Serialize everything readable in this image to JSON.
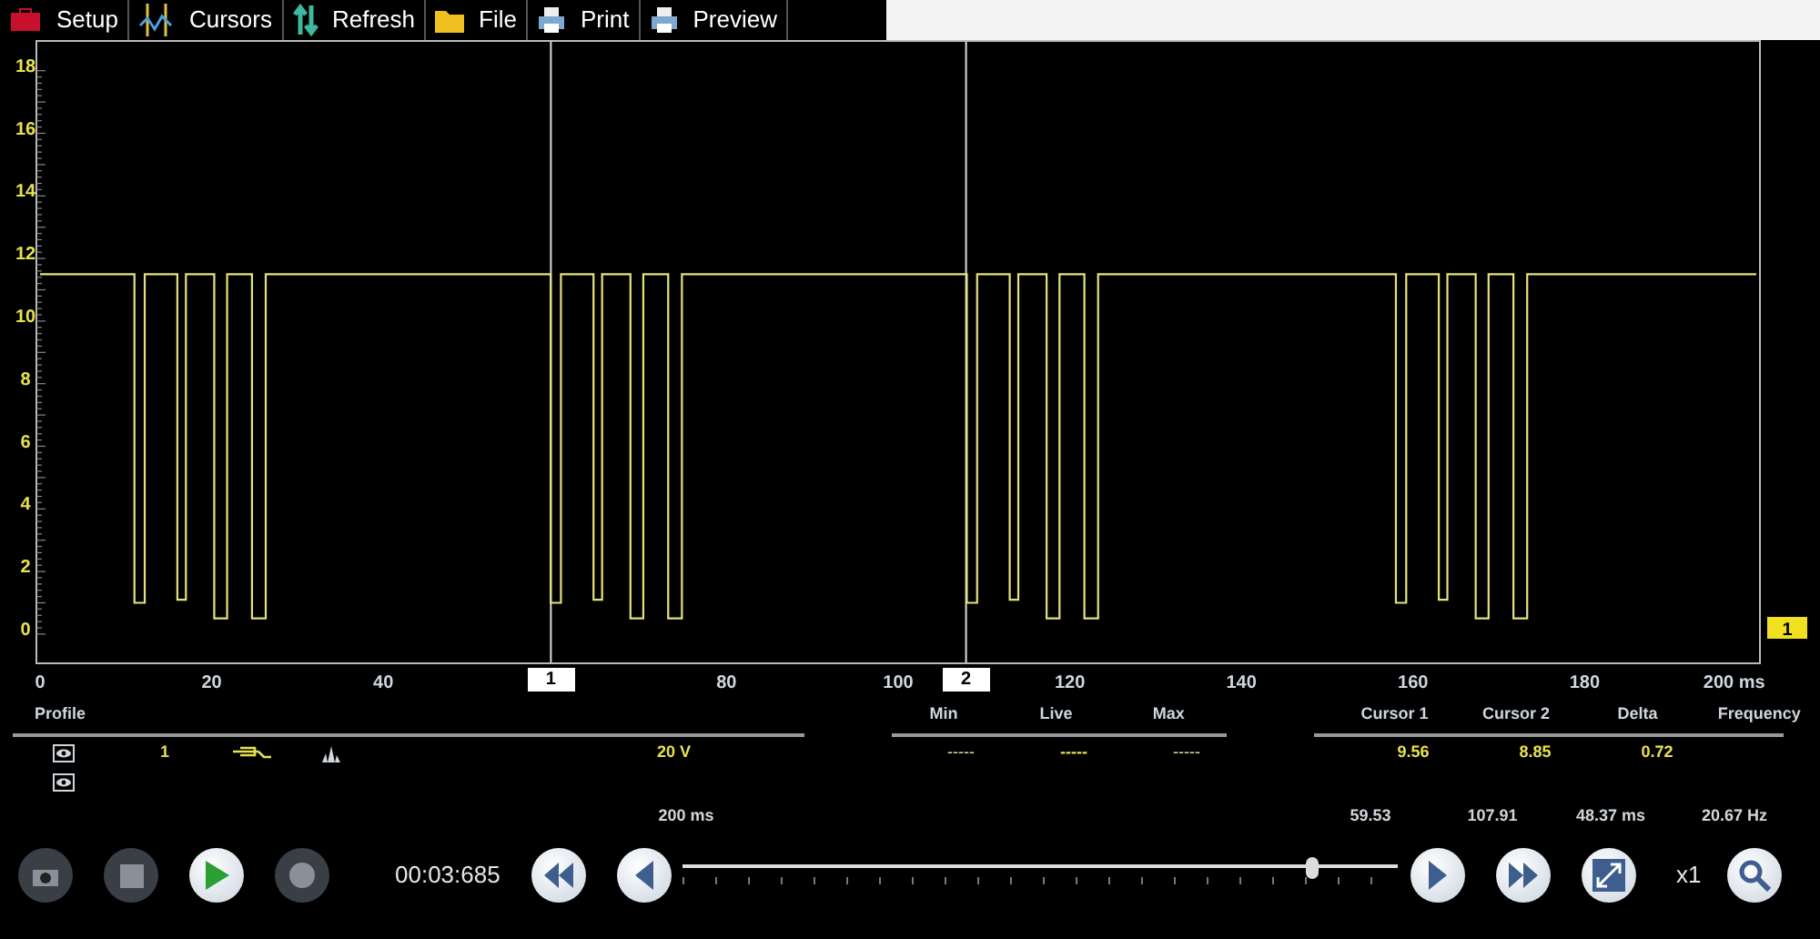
{
  "toolbar": [
    {
      "kind": "setup",
      "label": "Setup"
    },
    {
      "kind": "cursors",
      "label": "Cursors"
    },
    {
      "kind": "refresh",
      "label": "Refresh"
    },
    {
      "kind": "file",
      "label": "File"
    },
    {
      "kind": "print",
      "label": "Print"
    },
    {
      "kind": "preview",
      "label": "Preview"
    }
  ],
  "plot": {
    "y_ticks": [
      "18",
      "16",
      "14",
      "12",
      "10",
      "8",
      "6",
      "4",
      "2",
      "0"
    ],
    "x_ticks": [
      "0",
      "20",
      "40",
      "80",
      "100",
      "120",
      "140",
      "160",
      "180",
      "200 ms"
    ],
    "cursors": [
      {
        "label": "1"
      },
      {
        "label": "2"
      }
    ],
    "channel_marker": "1"
  },
  "profile": {
    "header": "Profile",
    "channels": [
      {
        "visible": true,
        "number": "1",
        "scale": "20 V"
      },
      {
        "visible": true
      }
    ]
  },
  "live_stats": {
    "columns": [
      "Min",
      "Live",
      "Max"
    ],
    "values": [
      "-----",
      "-----",
      "-----"
    ]
  },
  "cursor_stats": {
    "columns": [
      "Cursor 1",
      "Cursor 2",
      "Delta",
      "Frequency"
    ],
    "values": [
      "9.56",
      "8.85",
      "0.72"
    ],
    "time_values": [
      "59.53",
      "107.91",
      "48.37 ms",
      "20.67 Hz"
    ]
  },
  "timebase": "200 ms",
  "controls": {
    "left": [
      {
        "kind": "camera",
        "disabled": true
      },
      {
        "kind": "stop",
        "disabled": true
      },
      {
        "kind": "play",
        "disabled": false
      },
      {
        "kind": "record",
        "disabled": true
      }
    ],
    "time": "00:03:685",
    "nav_left": [
      {
        "kind": "rewind"
      },
      {
        "kind": "back"
      }
    ],
    "slider": {
      "level": 0.88
    },
    "nav_right": [
      {
        "kind": "forward"
      },
      {
        "kind": "fast-forward"
      },
      {
        "kind": "fit"
      }
    ],
    "zoom_label": "x1"
  }
}
